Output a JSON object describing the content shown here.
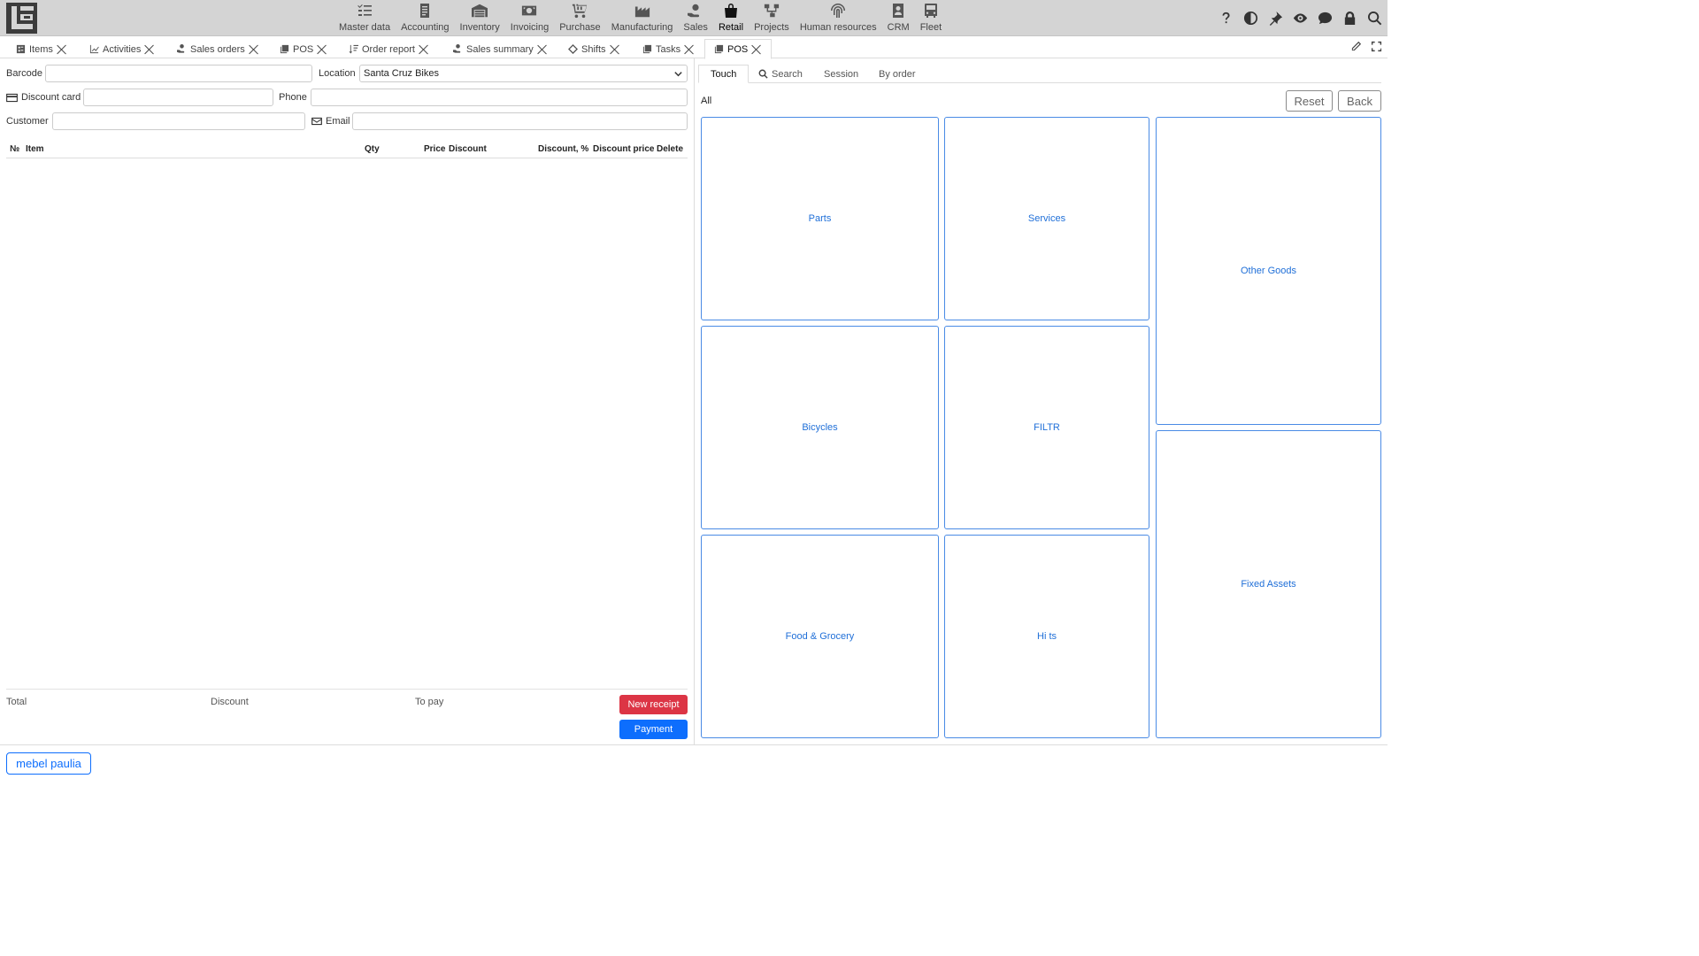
{
  "navbar": {
    "items": [
      {
        "label": "Master data",
        "icon": "list-check-icon"
      },
      {
        "label": "Accounting",
        "icon": "ledger-icon"
      },
      {
        "label": "Inventory",
        "icon": "warehouse-icon"
      },
      {
        "label": "Invoicing",
        "icon": "cash-icon"
      },
      {
        "label": "Purchase",
        "icon": "cart-icon"
      },
      {
        "label": "Manufacturing",
        "icon": "factory-icon"
      },
      {
        "label": "Sales",
        "icon": "hand-coin-icon"
      },
      {
        "label": "Retail",
        "icon": "shopping-bag-icon",
        "active": true
      },
      {
        "label": "Projects",
        "icon": "diagram-icon"
      },
      {
        "label": "Human resources",
        "icon": "fingerprint-icon"
      },
      {
        "label": "CRM",
        "icon": "contact-card-icon"
      },
      {
        "label": "Fleet",
        "icon": "bus-icon"
      }
    ],
    "tools": [
      "help-icon",
      "contrast-icon",
      "pin-icon",
      "eye-icon",
      "chat-icon",
      "lock-icon",
      "search-icon"
    ]
  },
  "tabs": [
    {
      "label": "Items",
      "icon": "items-icon"
    },
    {
      "label": "Activities",
      "icon": "chart-line-icon"
    },
    {
      "label": "Sales orders",
      "icon": "hand-coin-icon"
    },
    {
      "label": "POS",
      "icon": "copy-icon"
    },
    {
      "label": "Order report",
      "icon": "sort-icon"
    },
    {
      "label": "Sales summary",
      "icon": "hand-coin-icon"
    },
    {
      "label": "Shifts",
      "icon": "diamond-icon"
    },
    {
      "label": "Tasks",
      "icon": "copy-icon"
    },
    {
      "label": "POS",
      "icon": "copy-icon",
      "active": true
    }
  ],
  "form": {
    "barcode_label": "Barcode",
    "barcode_value": "",
    "location_label": "Location",
    "location_value": "Santa Cruz Bikes",
    "discount_card_label": "Discount card",
    "discount_card_value": "",
    "phone_label": "Phone",
    "phone_value": "",
    "customer_label": "Customer",
    "customer_value": "",
    "email_label": "Email",
    "email_value": ""
  },
  "table": {
    "columns": [
      "№",
      "Item",
      "Qty",
      "Price",
      "Discount",
      "Discount, %",
      "Discount price",
      "Delete"
    ],
    "rows": []
  },
  "summary": {
    "total_label": "Total",
    "discount_label": "Discount",
    "to_pay_label": "To pay",
    "new_receipt": "New receipt",
    "payment": "Payment"
  },
  "user": "mebel paulia",
  "right": {
    "tabs": [
      "Touch",
      "Search",
      "Session",
      "By order"
    ],
    "active_tab": "Touch",
    "breadcrumb": "All",
    "reset": "Reset",
    "back": "Back",
    "tiles": [
      "Parts",
      "Services",
      "Other Goods",
      "Bicycles",
      "FILTR",
      "Food & Grocery",
      "Hi ts",
      "Fixed Assets"
    ]
  },
  "colors": {
    "accent": "#0d6efd",
    "danger": "#dc3545",
    "tile_border": "#4a8be5",
    "tile_text": "#1f6fd8",
    "navbar_bg": "#d4d4d4"
  }
}
